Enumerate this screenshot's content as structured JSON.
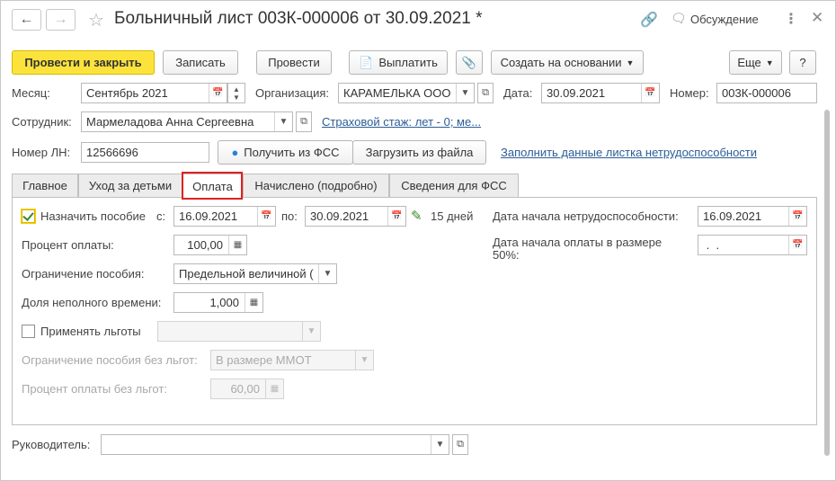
{
  "window": {
    "title": "Больничный лист 003К-000006 от 30.09.2021 *",
    "discussion_label": "Обсуждение"
  },
  "toolbar": {
    "post_close": "Провести и закрыть",
    "save": "Записать",
    "post": "Провести",
    "pay": "Выплатить",
    "create_based": "Создать на основании",
    "more": "Еще",
    "help": "?"
  },
  "header": {
    "month_label": "Месяц:",
    "month_value": "Сентябрь 2021",
    "org_label": "Организация:",
    "org_value": "КАРАМЕЛЬКА ООО",
    "date_label": "Дата:",
    "date_value": "30.09.2021",
    "number_label": "Номер:",
    "number_value": "003К-000006",
    "employee_label": "Сотрудник:",
    "employee_value": "Мармеладова Анна Сергеевна",
    "insurance_link": "Страховой стаж: лет - 0; ме...",
    "ln_label": "Номер ЛН:",
    "ln_value": "12566696",
    "get_fss": "Получить из ФСС",
    "load_file": "Загрузить из файла",
    "fill_link": "Заполнить данные листка нетрудоспособности"
  },
  "tabs": [
    {
      "label": "Главное"
    },
    {
      "label": "Уход за детьми"
    },
    {
      "label": "Оплата"
    },
    {
      "label": "Начислено (подробно)"
    },
    {
      "label": "Сведения для ФСС"
    }
  ],
  "payment": {
    "assign_label": "Назначить пособие",
    "from_label": "с:",
    "from_value": "16.09.2021",
    "to_label": "по:",
    "to_value": "30.09.2021",
    "days": "15 дней",
    "disability_start_label": "Дата начала нетрудоспособности:",
    "disability_start_value": "16.09.2021",
    "pay_start_label_line1": "Дата начала оплаты в размере",
    "pay_start_label_line2": "50%:",
    "pay_start_value": " .  .",
    "percent_label": "Процент оплаты:",
    "percent_value": "100,00",
    "limit_label": "Ограничение пособия:",
    "limit_value": "Предельной величиной (",
    "part_time_label": "Доля неполного времени:",
    "part_time_value": "1,000",
    "benefits_label": "Применять льготы",
    "benefits_value": "",
    "limit_no_benefits_label": "Ограничение пособия без льгот:",
    "limit_no_benefits_value": "В размере ММОТ",
    "percent_no_benefits_label": "Процент оплаты без льгот:",
    "percent_no_benefits_value": "60,00"
  },
  "footer": {
    "manager_label": "Руководитель:",
    "manager_value": ""
  }
}
